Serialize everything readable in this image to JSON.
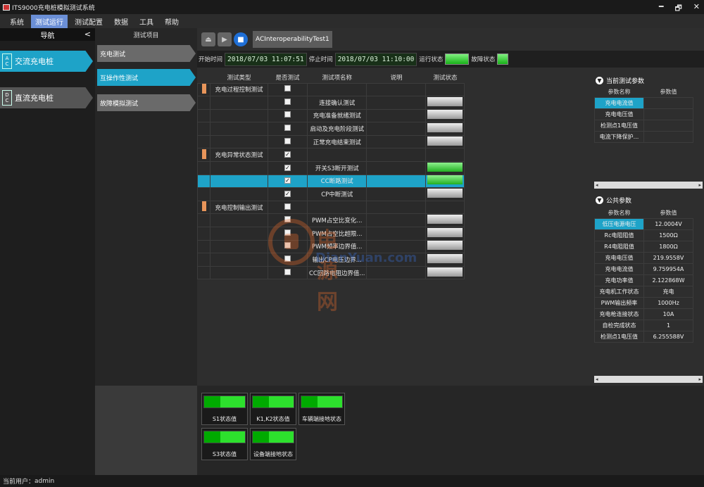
{
  "window": {
    "title": "ITS9000充电桩模拟测试系统",
    "controls": [
      "━",
      "🗗",
      "✕"
    ]
  },
  "menu": [
    "系统",
    "测试运行",
    "测试配置",
    "数据",
    "工具",
    "帮助"
  ],
  "nav": {
    "title": "导航",
    "collapse": "<",
    "items": [
      {
        "label": "交流充电桩",
        "icon_top": "A",
        "icon_bottom": "C"
      },
      {
        "label": "直流充电桩",
        "icon_top": "D",
        "icon_bottom": "C"
      }
    ]
  },
  "subnav": {
    "title": "测试项目",
    "items": [
      "充电测试",
      "互操作性测试",
      "故障模拟测试"
    ]
  },
  "toolbar": {
    "tab_label": "ACInteroperabilityTest1"
  },
  "timebar": {
    "start_label": "开始时间",
    "start_value": "2018/07/03 11:07:51",
    "stop_label": "停止时间",
    "stop_value": "2018/07/03 11:10:00",
    "run_label": "运行状态",
    "fault_label": "故障状态"
  },
  "tests": {
    "headers": [
      "测试类型",
      "是否测试",
      "测试项名称",
      "说明",
      "测试状态"
    ],
    "rows": [
      {
        "type": "充电过程控制测试",
        "checked": false,
        "name": "",
        "marker": true,
        "status": ""
      },
      {
        "type": "",
        "checked": false,
        "name": "连接确认测试",
        "status": "gray",
        "graycb": true
      },
      {
        "type": "",
        "checked": false,
        "name": "充电准备就绪测试",
        "status": "gray",
        "graycb": true
      },
      {
        "type": "",
        "checked": false,
        "name": "启动及充电阶段测试",
        "status": "gray",
        "graycb": true
      },
      {
        "type": "",
        "checked": false,
        "name": "正常充电结束测试",
        "status": "gray",
        "graycb": true
      },
      {
        "type": "充电异常状态测试",
        "checked": true,
        "name": "",
        "marker": true,
        "status": ""
      },
      {
        "type": "",
        "checked": true,
        "name": "开关S3断开测试",
        "status": "green"
      },
      {
        "type": "",
        "checked": true,
        "name": "CC断路测试",
        "status": "green",
        "selected": true
      },
      {
        "type": "",
        "checked": true,
        "name": "CP中断测试",
        "status": "gray"
      },
      {
        "type": "充电控制输出测试",
        "checked": false,
        "name": "",
        "marker": true,
        "status": ""
      },
      {
        "type": "",
        "checked": false,
        "name": "PWM占空比变化...",
        "status": "gray"
      },
      {
        "type": "",
        "checked": false,
        "name": "PWM占空比超限...",
        "status": "gray"
      },
      {
        "type": "",
        "checked": false,
        "name": "PWM频率边界值...",
        "status": "gray"
      },
      {
        "type": "",
        "checked": false,
        "name": "输出CP电压边界...",
        "status": "gray"
      },
      {
        "type": "",
        "checked": false,
        "name": "CC回路电阻边界值...",
        "status": "gray"
      }
    ]
  },
  "current_params": {
    "title": "当前测试参数",
    "headers": [
      "参数名称",
      "参数值"
    ],
    "rows": [
      [
        "充电电流值",
        ""
      ],
      [
        "充电电压值",
        ""
      ],
      [
        "检测点1电压值",
        ""
      ],
      [
        "电流下降保护...",
        ""
      ]
    ]
  },
  "public_params": {
    "title": "公共参数",
    "headers": [
      "参数名称",
      "参数值"
    ],
    "rows": [
      [
        "低压电源电压",
        "12.0004V"
      ],
      [
        "Rc电阻阻值",
        "1500Ω"
      ],
      [
        "R4电阻阻值",
        "1800Ω"
      ],
      [
        "充电电压值",
        "219.9558V"
      ],
      [
        "充电电流值",
        "9.759954A"
      ],
      [
        "充电功率值",
        "2.122868W"
      ],
      [
        "充电机工作状态",
        "充电"
      ],
      [
        "PWM输出频率",
        "1000Hz"
      ],
      [
        "充电枪连接状态",
        "10A"
      ],
      [
        "自检完成状态",
        "1"
      ],
      [
        "检测点1电压值",
        "6.255588V"
      ]
    ]
  },
  "status_indicators": [
    "S1状态值",
    "K1,K2状态值",
    "车辆端接地状态",
    "S3状态值",
    "设备端接地状态"
  ],
  "watermark": {
    "text": "电源网",
    "url": "DianYuan.com"
  },
  "statusbar": {
    "user_label": "当前用户：",
    "user": "admin"
  }
}
